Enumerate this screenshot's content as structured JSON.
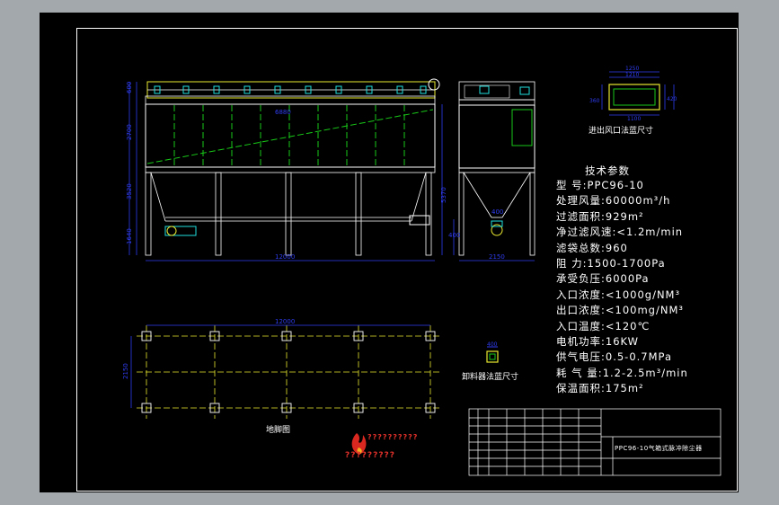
{
  "captions": {
    "flange_inout": "进出风口法蓝尺寸",
    "flange_discharge": "卸料器法蓝尺寸",
    "foundation": "地脚图"
  },
  "tech": {
    "title": "技术参数",
    "rows": [
      {
        "label": "型      号:",
        "value": "PPC96-10"
      },
      {
        "label": "处理风量:",
        "value": "60000m³/h"
      },
      {
        "label": "过滤面积:",
        "value": "929m²"
      },
      {
        "label": "净过滤风速:",
        "value": "<1.2m/min"
      },
      {
        "label": "滤袋总数:",
        "value": "960"
      },
      {
        "label": "阻      力:",
        "value": "1500-1700Pa"
      },
      {
        "label": "承受负压:",
        "value": "6000Pa"
      },
      {
        "label": "入口浓度:",
        "value": "<1000g/NM³"
      },
      {
        "label": "出口浓度:",
        "value": "<100mg/NM³"
      },
      {
        "label": "入口温度:",
        "value": "<120℃"
      },
      {
        "label": "电机功率:",
        "value": "16KW"
      },
      {
        "label": "供气电压:",
        "value": "0.5-0.7MPa"
      },
      {
        "label": "耗  气  量:",
        "value": "1.2-2.5m³/min"
      },
      {
        "label": "保温面积:",
        "value": "175m²"
      }
    ]
  },
  "title_block": {
    "drawing_title": "PPC96-10气箱式脉冲除尘器"
  },
  "logo_text": "??????????",
  "logo_sub": "?????????",
  "colors": {
    "background": "#a3a8ad",
    "sheet": "#000000",
    "outline": "#ffffff",
    "dimension": "#2f3df2",
    "structure": "#e8e830",
    "bags": "#18c818",
    "accent": "#20e0e0"
  }
}
